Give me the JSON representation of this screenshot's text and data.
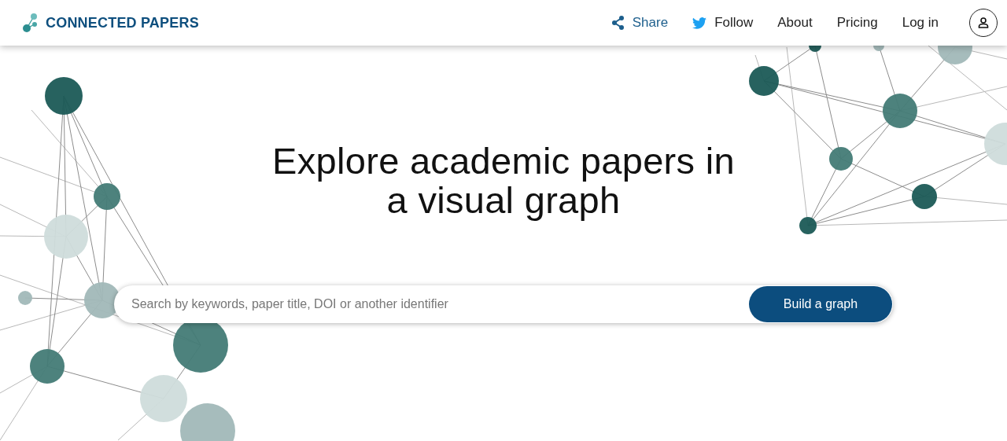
{
  "header": {
    "logo": "CONNECTED PAPERS",
    "nav": [
      {
        "kind": "share",
        "label": "Share"
      },
      {
        "kind": "twitter",
        "label": "Follow"
      },
      {
        "kind": "link",
        "label": "About"
      },
      {
        "kind": "link",
        "label": "Pricing"
      },
      {
        "kind": "link",
        "label": "Log in"
      }
    ]
  },
  "hero": {
    "title": "Explore academic papers in a visual graph"
  },
  "search": {
    "placeholder": "Search by keywords, paper title, DOI or another identifier",
    "button": "Build a graph"
  }
}
